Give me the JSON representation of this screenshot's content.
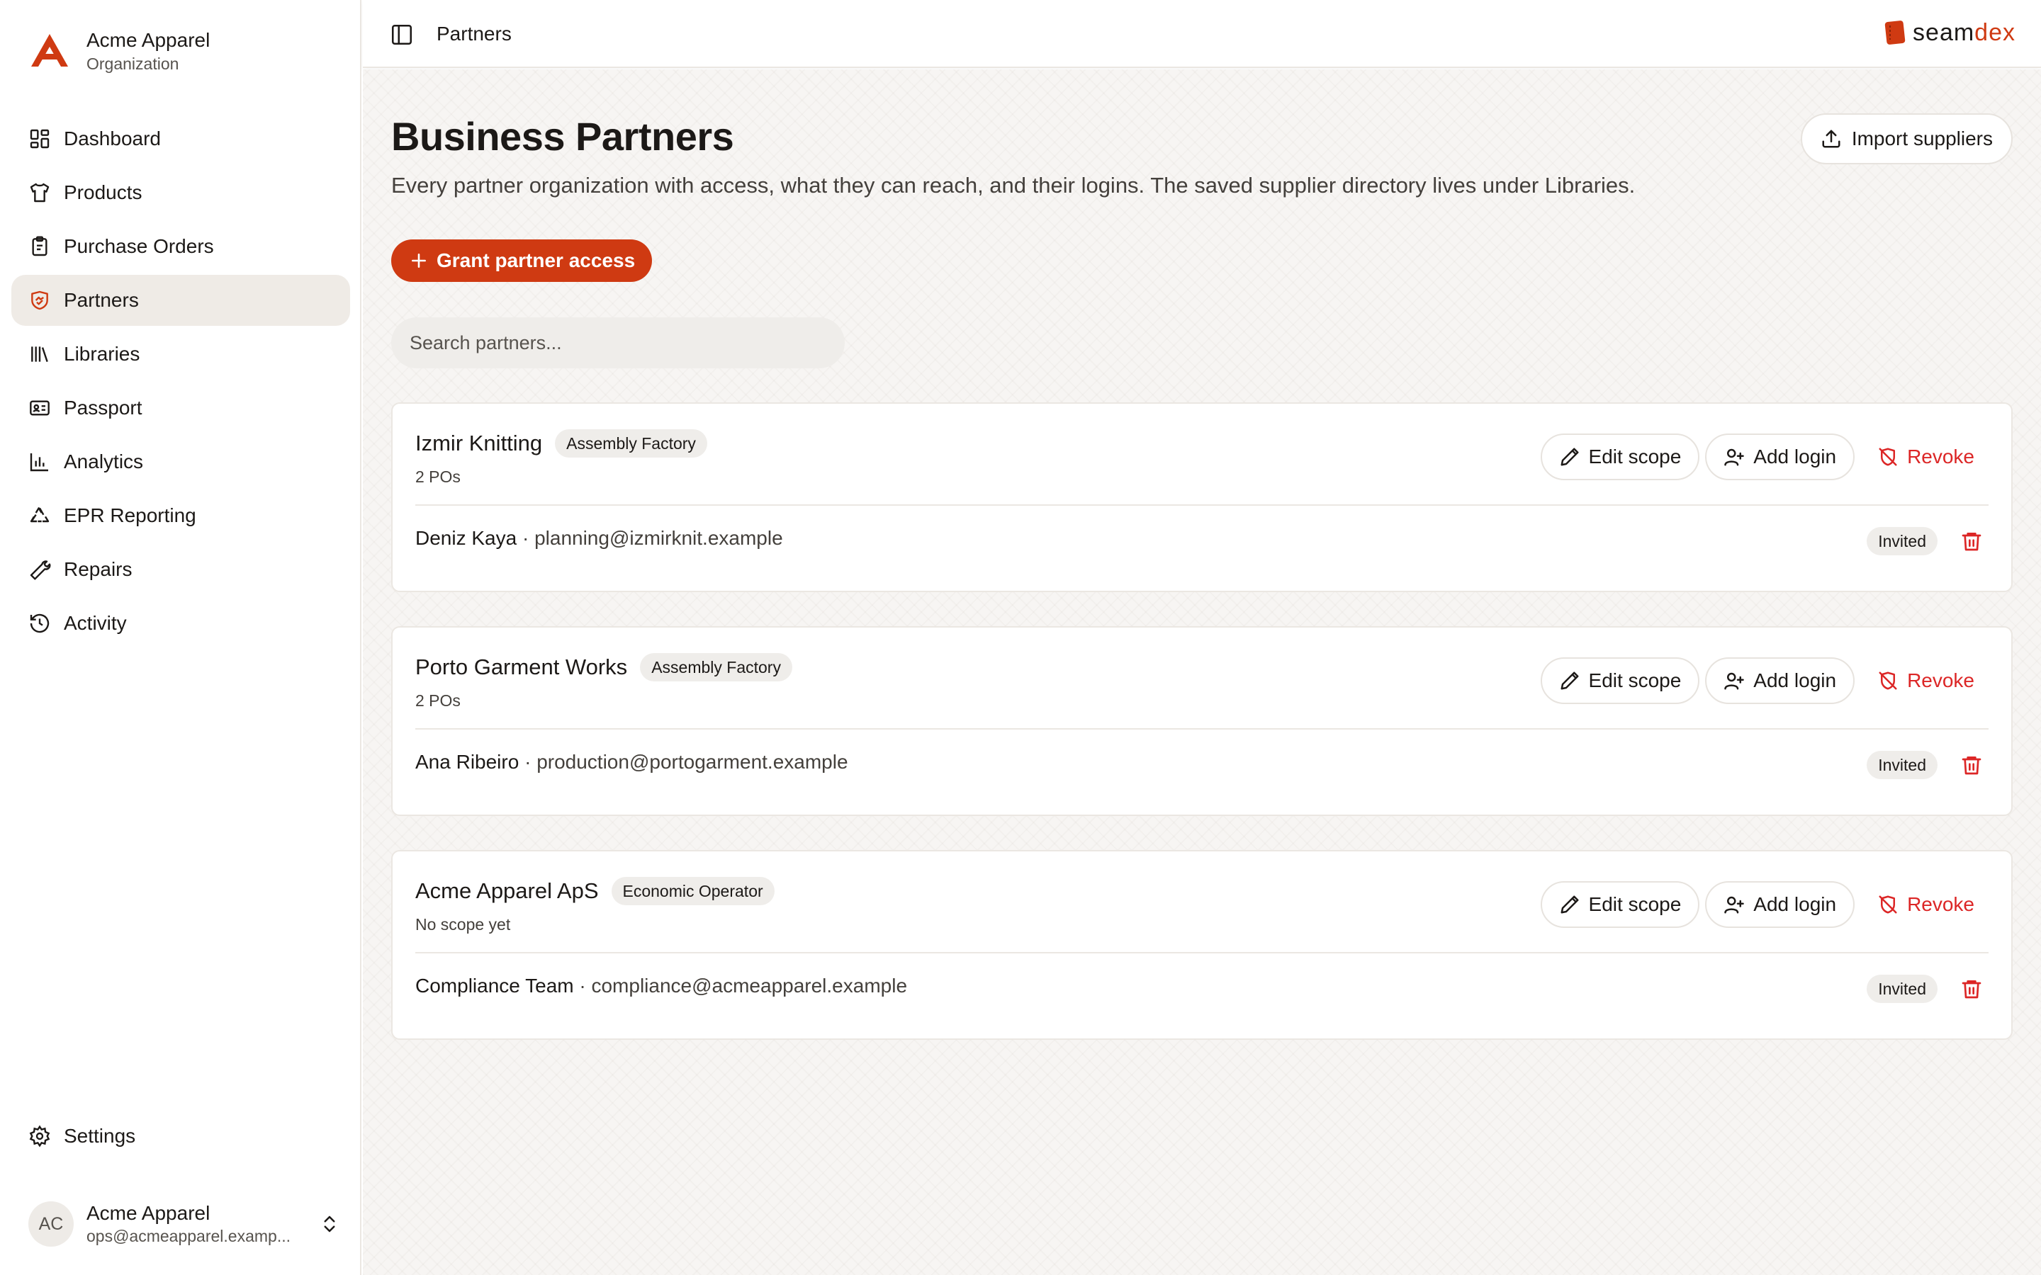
{
  "org": {
    "name": "Acme Apparel",
    "type": "Organization"
  },
  "sidebar": {
    "items": [
      {
        "label": "Dashboard",
        "icon": "dashboard-icon",
        "active": false
      },
      {
        "label": "Products",
        "icon": "shirt-icon",
        "active": false
      },
      {
        "label": "Purchase Orders",
        "icon": "clipboard-icon",
        "active": false
      },
      {
        "label": "Partners",
        "icon": "handshake-icon",
        "active": true
      },
      {
        "label": "Libraries",
        "icon": "library-icon",
        "active": false
      },
      {
        "label": "Passport",
        "icon": "id-card-icon",
        "active": false
      },
      {
        "label": "Analytics",
        "icon": "bar-chart-icon",
        "active": false
      },
      {
        "label": "EPR Reporting",
        "icon": "recycle-icon",
        "active": false
      },
      {
        "label": "Repairs",
        "icon": "wrench-icon",
        "active": false
      },
      {
        "label": "Activity",
        "icon": "history-icon",
        "active": false
      }
    ],
    "settings_label": "Settings"
  },
  "user": {
    "initials": "AC",
    "name": "Acme Apparel",
    "email": "ops@acmeapparel.examp..."
  },
  "topbar": {
    "breadcrumb": "Partners",
    "brand_part1": "seam",
    "brand_part2": "dex"
  },
  "colors": {
    "accent": "#cf3a12",
    "danger": "#dc2626",
    "active_nav_bg": "#efebe6"
  },
  "page": {
    "title": "Business Partners",
    "description": "Every partner organization with access, what they can reach, and their logins. The saved supplier directory lives under Libraries.",
    "import_label": "Import suppliers",
    "grant_label": "Grant partner access",
    "search_placeholder": "Search partners..."
  },
  "actions": {
    "edit_scope": "Edit scope",
    "add_login": "Add login",
    "revoke": "Revoke"
  },
  "partners": [
    {
      "name": "Izmir Knitting",
      "role": "Assembly Factory",
      "scope": "2 POs",
      "login_name": "Deniz Kaya",
      "login_email": "· planning@izmirknit.example",
      "status": "Invited"
    },
    {
      "name": "Porto Garment Works",
      "role": "Assembly Factory",
      "scope": "2 POs",
      "login_name": "Ana Ribeiro",
      "login_email": "· production@portogarment.example",
      "status": "Invited"
    },
    {
      "name": "Acme Apparel ApS",
      "role": "Economic Operator",
      "scope": "No scope yet",
      "login_name": "Compliance Team",
      "login_email": "· compliance@acmeapparel.example",
      "status": "Invited"
    }
  ]
}
